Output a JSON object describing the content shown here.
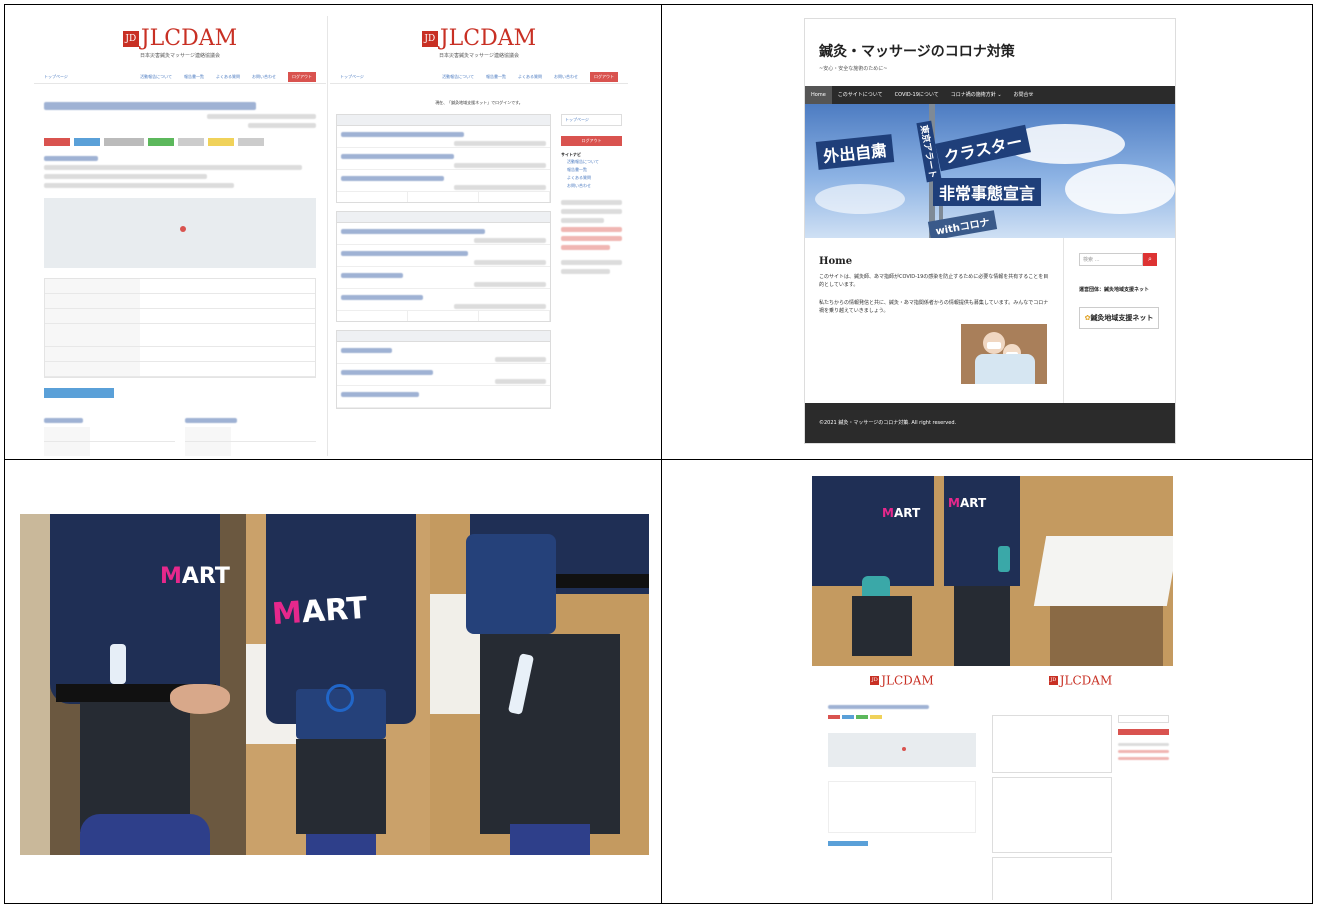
{
  "jlcdam": {
    "logo_mark": "JD",
    "logo_text": "JLCDAM",
    "logo_subtitle": "日本災害鍼灸マッサージ連絡協議会",
    "nav": [
      "トップページ",
      "活動報告について",
      "報告書一覧",
      "よくある質問",
      "お問い合わせ",
      "ログアウト"
    ],
    "notice": "現在、「鍼灸地域支援ネット」でログインです。",
    "sidebar_top": "トップページ",
    "sidebar_logout": "ログアウト",
    "sidebar_nav_title": "サイトナビ",
    "sidebar_links": [
      "活動報告について",
      "報告書一覧",
      "よくある質問",
      "お問い合わせ"
    ]
  },
  "corona_site": {
    "title": "鍼灸・マッサージのコロナ対策",
    "subtitle": "~安心・安全な施術のために~",
    "nav": [
      "Home",
      "このサイトについて",
      "COVID-19について",
      "コロナ禍の施術方針 ⌄",
      "お問合せ"
    ],
    "banner_signs": [
      "外出自粛",
      "東京アラート",
      "クラスター",
      "非常事態宣言",
      "withコロナ"
    ],
    "home_heading": "Home",
    "paragraph1": "このサイトは、鍼灸師、あマ指師がCOVID-19の感染を防止するために必要な情報を共有することを目的としています。",
    "paragraph2": "私たちからの情報発信と共に、鍼灸・あマ指関係者からの情報提供も募集しています。みんなでコロナ禍を乗り越えていきましょう。",
    "search_placeholder": "検索 …",
    "sidebar_heading": "運営団体：鍼灸地域支援ネット",
    "sidebar_logo": "鍼灸地域支援ネット",
    "footer": "©2021 鍼灸・マッサージのコロナ対策. All right reserved."
  },
  "photos": {
    "shirt_print": "ART",
    "colors": {
      "shirt_navy": "#1f2f55",
      "art_pink": "#e6288c",
      "pouch_blue": "#25417a",
      "teal_bottle": "#3aa8a8"
    }
  }
}
